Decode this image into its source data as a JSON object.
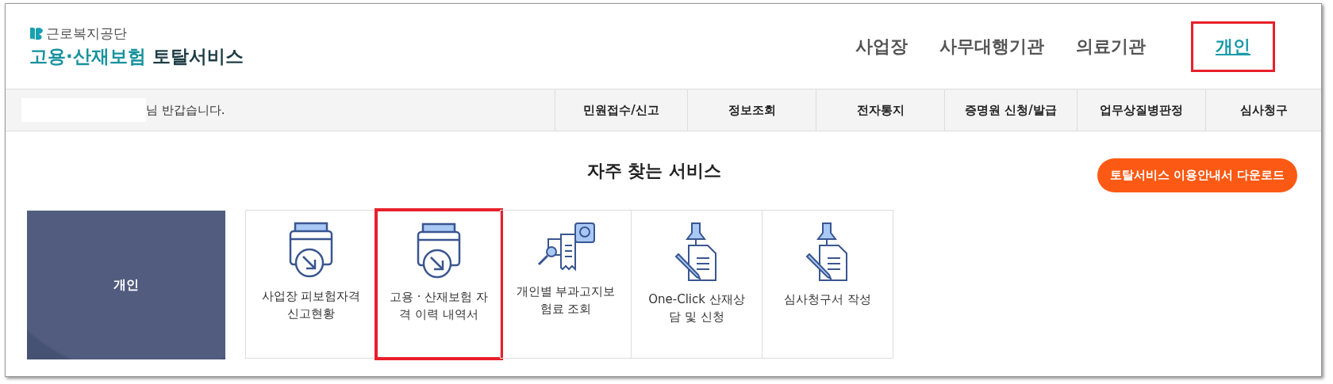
{
  "logo": {
    "org": "근로복지공단",
    "title_main": "고용·산재보험",
    "title_sub": "토탈서비스"
  },
  "top_nav": [
    {
      "label": "사업장",
      "selected": false,
      "highlighted": false
    },
    {
      "label": "사무대행기관",
      "selected": false,
      "highlighted": false
    },
    {
      "label": "의료기관",
      "selected": false,
      "highlighted": false
    },
    {
      "label": "개인",
      "selected": true,
      "highlighted": true
    }
  ],
  "greeting": "님 반갑습니다.",
  "menu": [
    "민원접수/신고",
    "정보조회",
    "전자통지",
    "증명원 신청/발급",
    "업무상질병판정",
    "심사청구"
  ],
  "section_title": "자주 찾는 서비스",
  "download_button": "토탈서비스 이용안내서 다운로드",
  "panel_label": "개인",
  "services": [
    {
      "label": "사업장 피보험자격 신고현황",
      "kind": "download",
      "highlighted": false
    },
    {
      "label": "고용 · 산재보험 자격 이력 내역서",
      "kind": "download",
      "highlighted": true
    },
    {
      "label": "개인별 부과고지보험료 조회",
      "kind": "search",
      "highlighted": false
    },
    {
      "label": "One-Click 산재상담 및 신청",
      "kind": "pin",
      "highlighted": false
    },
    {
      "label": "심사청구서 작성",
      "kind": "pin",
      "highlighted": false
    }
  ]
}
